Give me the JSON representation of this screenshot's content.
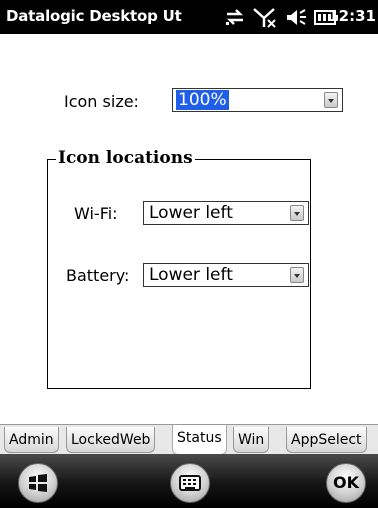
{
  "statusbar": {
    "title": "Datalogic Desktop Ut",
    "time": "12:31",
    "icons": [
      "connectivity-icon",
      "signal-off-icon",
      "speaker-icon",
      "battery-icon"
    ]
  },
  "form": {
    "icon_size_label": "Icon size:",
    "icon_size_value": "100%",
    "group_title": "Icon locations",
    "wifi_label": "Wi-Fi:",
    "wifi_value": "Lower left",
    "battery_label": "Battery:",
    "battery_value": "Lower left"
  },
  "tabs": [
    {
      "label": "Admin"
    },
    {
      "label": "LockedWeb"
    },
    {
      "label": "Status",
      "active": true
    },
    {
      "label": "Win"
    },
    {
      "label": "AppSelect"
    }
  ],
  "softkeys": {
    "ok_label": "OK",
    "icons": [
      "windows-start-icon",
      "keyboard-icon"
    ]
  }
}
